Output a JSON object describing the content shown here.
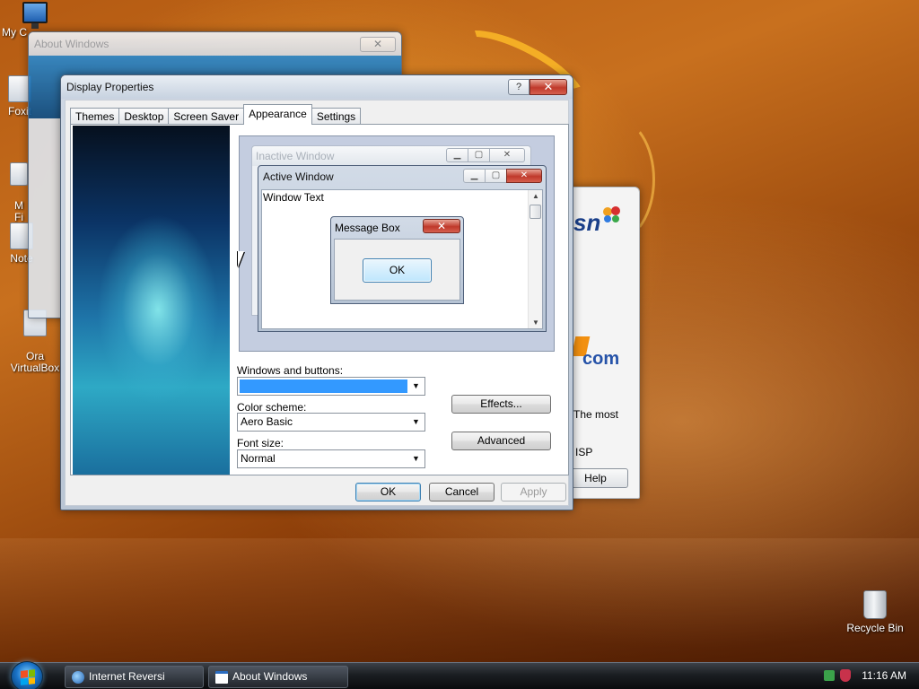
{
  "desktop": {
    "icons": [
      {
        "label": "My C"
      },
      {
        "label": "Foxit"
      },
      {
        "label": "M\nFi"
      },
      {
        "label": "Note"
      },
      {
        "label": "Ora\nVirtualBox"
      }
    ],
    "recycle_bin": "Recycle Bin"
  },
  "about_window": {
    "title": "About Windows",
    "close": "✕"
  },
  "ie_window": {
    "msn": "sn",
    "com": "com",
    "text1": "The most",
    "text2": "ISP",
    "help_button": "Help"
  },
  "display_properties": {
    "title": "Display Properties",
    "help_glyph": "?",
    "close_glyph": "✕",
    "tabs": [
      "Themes",
      "Desktop",
      "Screen Saver",
      "Appearance",
      "Settings"
    ],
    "active_tab": "Appearance",
    "preview": {
      "inactive_title": "Inactive Window",
      "active_title": "Active Window",
      "window_text": "Window Text",
      "message_box_title": "Message Box",
      "message_box_ok": "OK"
    },
    "windows_and_buttons": {
      "label": "Windows and buttons:",
      "value": ""
    },
    "color_scheme": {
      "label": "Color scheme:",
      "value": "Aero Basic"
    },
    "font_size": {
      "label": "Font size:",
      "value": "Normal"
    },
    "effects_button": "Effects...",
    "advanced_button": "Advanced",
    "ok_button": "OK",
    "cancel_button": "Cancel",
    "apply_button": "Apply"
  },
  "taskbar": {
    "items": [
      "Internet Reversi",
      "About Windows"
    ],
    "clock": "11:16 AM"
  },
  "colors": {
    "selection_blue": "#3399ff",
    "close_red": "#c0392b"
  }
}
